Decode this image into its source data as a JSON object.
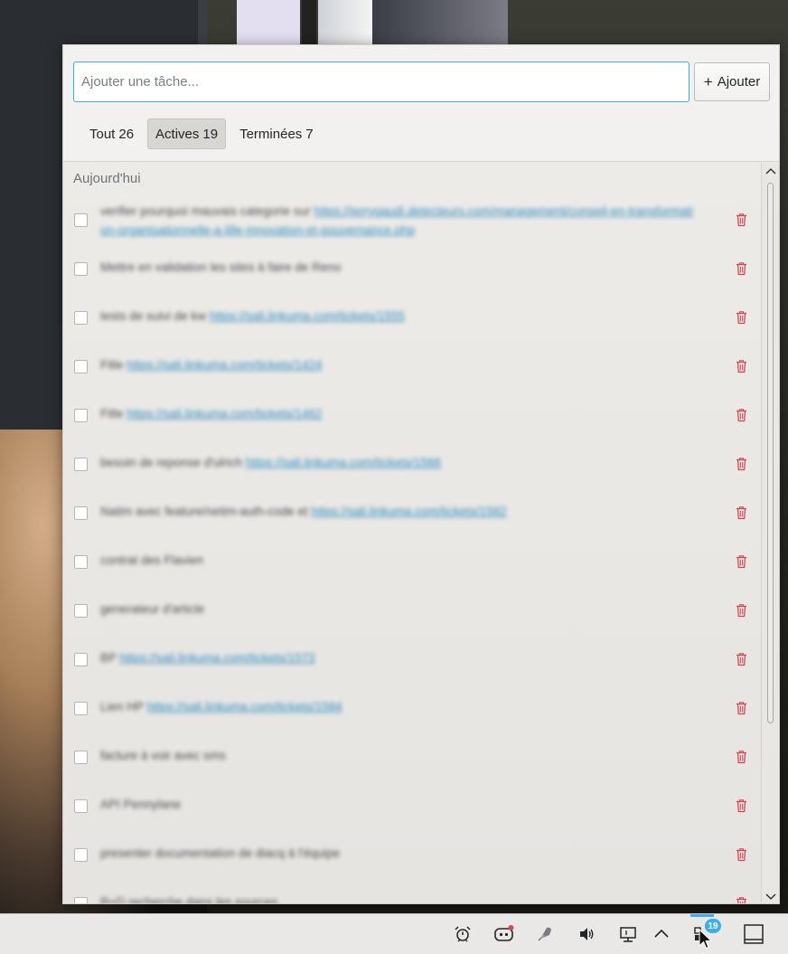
{
  "input": {
    "placeholder": "Ajouter une tâche...",
    "value": ""
  },
  "add_button": {
    "label": "Ajouter",
    "icon": "plus-icon"
  },
  "filters": [
    {
      "label": "Tout",
      "count": "26",
      "active": false
    },
    {
      "label": "Actives",
      "count": "19",
      "active": true
    },
    {
      "label": "Terminées",
      "count": "7",
      "active": false
    }
  ],
  "section": {
    "heading": "Aujourd'hui"
  },
  "tasks": [
    {
      "text": "verifier pourquoi mauvais categorie sur",
      "link": "https://jerrygaudi.detecteurs.com/management/conseil-en-transformation-organisationnelle-a-lille-innovation-et-gouvernance.php"
    },
    {
      "text": "Mettre en validation les sites à faire de Reno",
      "link": ""
    },
    {
      "text": "tests de suivi de kw",
      "link": "https://sali.linkuma.com/tickets/1555"
    },
    {
      "text": "Fitle",
      "link": "https://sali.linkuma.com/tickets/1424"
    },
    {
      "text": "Fitle",
      "link": "https://sali.linkuma.com/tickets/1462"
    },
    {
      "text": "besoin de reponse d'ulrich",
      "link": "https://sali.linkuma.com/tickets/1566"
    },
    {
      "text": "Natim avec feature/netim-auth-code et",
      "link": "https://sali.linkuma.com/tickets/1582"
    },
    {
      "text": "contrat des Flavien",
      "link": ""
    },
    {
      "text": "generateur d'article",
      "link": ""
    },
    {
      "text": "BP",
      "link": "https://sali.linkuma.com/tickets/1573"
    },
    {
      "text": "Lien HP",
      "link": "https://sali.linkuma.com/tickets/1584"
    },
    {
      "text": "facture à voir avec sms",
      "link": ""
    },
    {
      "text": "API Pennylane",
      "link": ""
    },
    {
      "text": "presenter documentation de diacq à l'équipe",
      "link": ""
    },
    {
      "text": "R+D recherche dans les sources",
      "link": ""
    }
  ],
  "taskbar": {
    "tray_icons": [
      "alarm-clock-icon",
      "discord-icon",
      "rocket-icon",
      "volume-icon",
      "network-icon",
      "chevron-up-icon",
      "todo-applet-icon",
      "show-desktop-icon"
    ],
    "badge_count": "19"
  },
  "colors": {
    "accent": "#3daee9",
    "delete": "#da4453",
    "link": "#2f8dc4"
  }
}
